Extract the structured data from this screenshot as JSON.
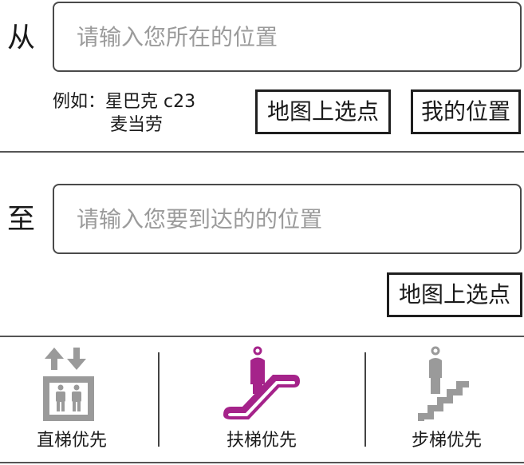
{
  "from": {
    "label": "从",
    "placeholder": "请输入您所在的位置",
    "hint_prefix": "例如：星巴克 c23",
    "hint_line2": "麦当劳",
    "map_pick_label": "地图上选点",
    "my_location_label": "我的位置"
  },
  "to": {
    "label": "至",
    "placeholder": "请输入您要到达的的位置",
    "map_pick_label": "地图上选点"
  },
  "preferences": {
    "selected": "escalator",
    "active_color": "#a5238a",
    "inactive_color": "#9a9a9a",
    "items": [
      {
        "id": "elevator",
        "label": "直梯优先",
        "icon": "elevator-icon"
      },
      {
        "id": "escalator",
        "label": "扶梯优先",
        "icon": "escalator-icon"
      },
      {
        "id": "stairs",
        "label": "步梯优先",
        "icon": "stairs-icon"
      }
    ]
  }
}
